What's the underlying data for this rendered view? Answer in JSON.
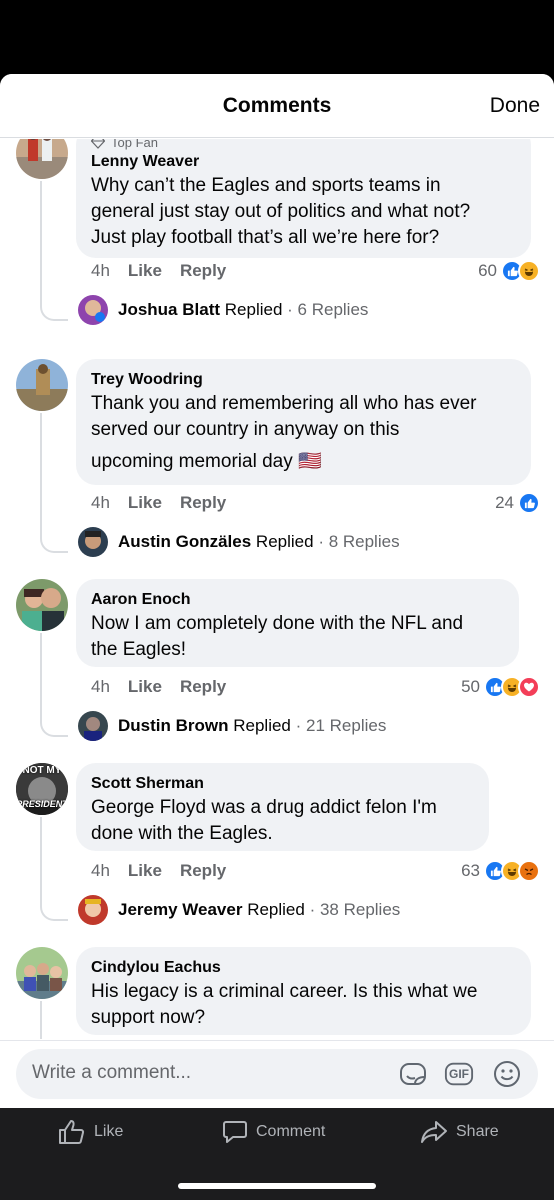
{
  "header": {
    "title": "Comments",
    "done_label": "Done"
  },
  "comments": [
    {
      "badge": "Top Fan",
      "author": "Lenny Weaver",
      "lines": [
        "Why can’t the Eagles and sports teams in",
        "general just stay out of politics and what not?",
        "Just play football that’s all we’re here for?"
      ],
      "time": "4h",
      "like_label": "Like",
      "reply_label": "Reply",
      "reaction_count": "60",
      "reactions": [
        "like",
        "haha"
      ],
      "reply_author": "Joshua Blatt",
      "reply_verb": "Replied",
      "reply_count": "· 6 Replies"
    },
    {
      "author": "Trey Woodring",
      "lines": [
        "Thank you and remembering all who has ever",
        "served our country in anyway on this",
        "upcoming memorial day 🇺🇸"
      ],
      "time": "4h",
      "like_label": "Like",
      "reply_label": "Reply",
      "reaction_count": "24",
      "reactions": [
        "like"
      ],
      "reply_author": "Austin Gonzäles",
      "reply_verb": "Replied",
      "reply_count": "· 8 Replies"
    },
    {
      "author": "Aaron Enoch",
      "lines": [
        "Now I am completely done with the NFL and",
        "the Eagles!"
      ],
      "time": "4h",
      "like_label": "Like",
      "reply_label": "Reply",
      "reaction_count": "50",
      "reactions": [
        "like",
        "haha",
        "love"
      ],
      "reply_author": "Dustin Brown",
      "reply_verb": "Replied",
      "reply_count": "· 21 Replies"
    },
    {
      "author": "Scott Sherman",
      "avatar_text": [
        "NOT MY",
        "PRESIDENT"
      ],
      "lines": [
        "George Floyd was a drug addict felon I'm",
        "done with the Eagles."
      ],
      "time": "4h",
      "like_label": "Like",
      "reply_label": "Reply",
      "reaction_count": "63",
      "reactions": [
        "like",
        "haha",
        "angry"
      ],
      "reply_author": "Jeremy Weaver",
      "reply_verb": "Replied",
      "reply_count": "· 38 Replies"
    },
    {
      "author": "Cindylou Eachus",
      "lines": [
        "His legacy is a criminal career. Is this what we",
        "support now?"
      ]
    }
  ],
  "composer": {
    "placeholder": "Write a comment...",
    "gif_label": "GIF"
  },
  "bottom_bar": {
    "like_label": "Like",
    "comment_label": "Comment",
    "share_label": "Share"
  },
  "colors": {
    "like_blue": "#1877f2",
    "haha_yellow": "#f7b125",
    "love_red": "#f33e58",
    "angry_orange": "#e9710f"
  }
}
